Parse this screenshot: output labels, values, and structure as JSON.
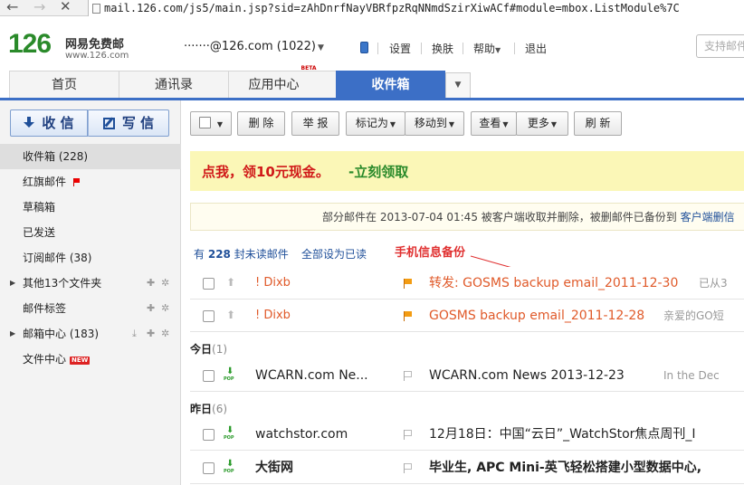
{
  "browser": {
    "back": "←",
    "forward": "→",
    "stop": "✕",
    "url": "mail.126.com/js5/main.jsp?sid=zAhDnrfNayVBRfpzRqNNmdSzirXiwACf#module=mbox.ListModule%7C"
  },
  "header": {
    "logo_number": "126",
    "logo_name": "网易免费邮",
    "logo_site": "www.126.com",
    "account": "·······@126.com (1022)",
    "links": [
      "设置",
      "换肤",
      "帮助",
      "退出"
    ],
    "support_placeholder": "支持邮件"
  },
  "tabs": [
    {
      "label": "首页"
    },
    {
      "label": "通讯录"
    },
    {
      "label": "应用中心",
      "badge": "BETA"
    },
    {
      "label": "收件箱"
    }
  ],
  "sidebar": {
    "receive": "收 信",
    "write": "写 信",
    "folders": [
      {
        "label": "收件箱 (228)"
      },
      {
        "label": "红旗邮件"
      },
      {
        "label": "草稿箱"
      },
      {
        "label": "已发送"
      },
      {
        "label": "订阅邮件 (38)"
      },
      {
        "label": "其他13个文件夹"
      },
      {
        "label": "邮件标签"
      },
      {
        "label": "邮箱中心 (183)"
      },
      {
        "label": "文件中心",
        "badge": "NEW"
      }
    ]
  },
  "toolbar": {
    "delete": "删 除",
    "report": "举 报",
    "mark_as": "标记为",
    "move_to": "移动到",
    "view": "查看",
    "more": "更多",
    "refresh": "刷 新"
  },
  "banner": {
    "main": "点我，领10元现金。",
    "link": "-立刻领取"
  },
  "notice": {
    "text": "部分邮件在 2013-07-04 01:45 被客户端收取并删除，被删邮件已备份到 ",
    "link": "客户端删信"
  },
  "summary": {
    "prefix": "有",
    "count": "228",
    "suffix": "封未读邮件",
    "mark_all": "全部设为已读"
  },
  "annotation": "手机信息备份",
  "groups": [
    {
      "label": "今日",
      "count": "(1)"
    },
    {
      "label": "昨日",
      "count": "(6)"
    }
  ],
  "mails": [
    {
      "sender": "! Dixb",
      "subject": "转发: GOSMS backup email_2011-12-30",
      "preview": "已从3"
    },
    {
      "sender": "! Dixb",
      "subject": "GOSMS backup email_2011-12-28",
      "preview": "亲爱的GO短"
    },
    {
      "sender": "WCARN.com Ne...",
      "subject": "WCARN.com News 2013-12-23",
      "preview": "In the Dec"
    },
    {
      "sender": "watchstor.com",
      "subject": "12月18日：中国“云日”_WatchStor焦点周刊_I",
      "preview": ""
    },
    {
      "sender": "大街网",
      "subject": "毕业生, APC Mini-英飞轻松搭建小型数据中心,",
      "preview": ""
    }
  ],
  "colors": {
    "accent": "#3c6fc6",
    "logo": "#2a8a2a",
    "unread_red": "#e05a2a",
    "banner_bg": "#fbf7b7"
  }
}
